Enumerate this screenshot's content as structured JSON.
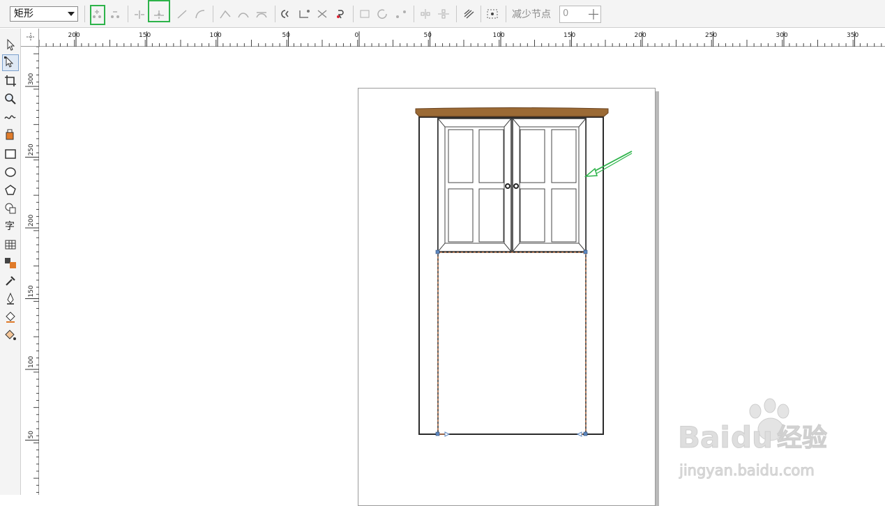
{
  "toolbar": {
    "shape_dropdown_value": "矩形",
    "reduce_nodes_label": "减少节点",
    "reduce_nodes_value": "0"
  },
  "toolbox": {
    "text_tool_glyph": "字"
  },
  "rulers": {
    "horizontal_ticks": [
      "200",
      "150",
      "100",
      "50",
      "0",
      "50",
      "100",
      "150",
      "200",
      "250",
      "300",
      "350"
    ],
    "vertical_ticks": [
      "300",
      "250",
      "200",
      "150",
      "100",
      "50"
    ]
  },
  "annotation": {
    "arrow_color": "#2db34a",
    "highlight_color": "#2db34a"
  },
  "watermark": {
    "brand": "Bai",
    "brand_suffix": "du",
    "cn": "经验",
    "url": "jingyan.baidu.com"
  },
  "colors": {
    "cornice": "#9b6a35",
    "outline": "#2a2a2a",
    "selection": "#c07a52"
  }
}
